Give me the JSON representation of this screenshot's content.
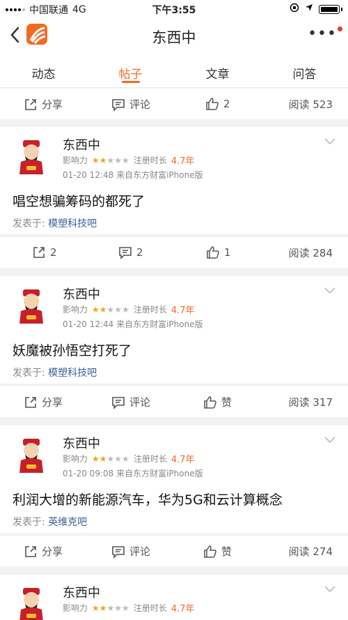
{
  "status": {
    "carrier": "中国联通",
    "network": "4G",
    "time": "下午3:55"
  },
  "nav": {
    "title": "东西中",
    "back_icon": "chevron-left-icon",
    "more_icon": "more-icon"
  },
  "tabs": [
    {
      "label": "动态"
    },
    {
      "label": "帖子",
      "active": true
    },
    {
      "label": "文章"
    },
    {
      "label": "问答"
    }
  ],
  "top_actions": {
    "share": "分享",
    "comment": "评论",
    "like": "2",
    "read": "阅读 523"
  },
  "posts": [
    {
      "author": "东西中",
      "influence": "影响力",
      "stars_on": 2,
      "stars_total": 5,
      "reg": "注册时长",
      "years": "4.7年",
      "meta": "01-20 12:48  来自东方财富iPhone版",
      "text": "唱空想骗筹码的都死了",
      "from_label": "发表于:",
      "forum": "模塑科技吧",
      "share": "2",
      "comment": "2",
      "like": "1",
      "read": "阅读 284"
    },
    {
      "author": "东西中",
      "influence": "影响力",
      "stars_on": 2,
      "stars_total": 5,
      "reg": "注册时长",
      "years": "4.7年",
      "meta": "01-20 12:44  来自东方财富iPhone版",
      "text": "妖魔被孙悟空打死了",
      "from_label": "发表于:",
      "forum": "模塑科技吧",
      "share": "分享",
      "comment": "评论",
      "like": "赞",
      "read": "阅读 317"
    },
    {
      "author": "东西中",
      "influence": "影响力",
      "stars_on": 2,
      "stars_total": 5,
      "reg": "注册时长",
      "years": "4.7年",
      "meta": "01-20 09:08  来自东方财富iPhone版",
      "text": "利润大增的新能源汽车，华为5G和云计算概念",
      "from_label": "发表于:",
      "forum": "英维克吧",
      "share": "分享",
      "comment": "评论",
      "like": "赞",
      "read": "阅读 274"
    },
    {
      "author": "东西中",
      "influence": "影响力",
      "stars_on": 2,
      "stars_total": 5,
      "reg": "注册时长",
      "years": "4.7年"
    }
  ],
  "colors": {
    "accent": "#f26a21",
    "link": "#3a5f9e",
    "star": "#f2a31c"
  }
}
